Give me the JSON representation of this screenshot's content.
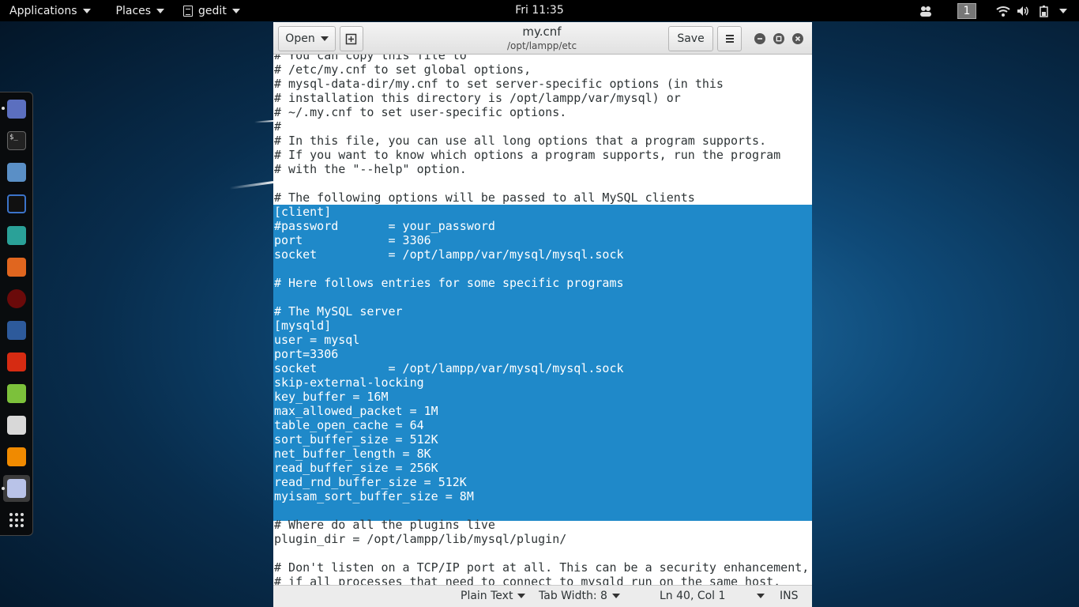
{
  "topbar": {
    "applications": "Applications",
    "places": "Places",
    "app_menu": "gedit",
    "clock": "Fri 11:35",
    "workspace": "1",
    "icons": [
      "people-icon",
      "wifi-icon",
      "volume-icon",
      "battery-icon",
      "power-menu-chevron-icon"
    ]
  },
  "dock": {
    "items": [
      "pidgin-icon",
      "terminal-icon",
      "files-icon",
      "metasploit-icon",
      "maltego-icon",
      "burpsuite-icon",
      "armitage-icon",
      "zaproxy-icon",
      "faraday-icon",
      "leafpad-icon",
      "cherrytree-icon",
      "vlc-icon",
      "gedit-icon",
      "show-apps-icon"
    ]
  },
  "window": {
    "title": "my.cnf",
    "subtitle": "/opt/lampp/etc",
    "open_label": "Open",
    "save_label": "Save",
    "new_tab_icon": "new-document-icon",
    "menu_icon": "hamburger-menu-icon",
    "controls": [
      "minimize-icon",
      "maximize-icon",
      "close-icon"
    ]
  },
  "editor": {
    "lines": [
      "# You can copy this file to",
      "# /etc/my.cnf to set global options,",
      "# mysql-data-dir/my.cnf to set server-specific options (in this",
      "# installation this directory is /opt/lampp/var/mysql) or",
      "# ~/.my.cnf to set user-specific options.",
      "#",
      "# In this file, you can use all long options that a program supports.",
      "# If you want to know which options a program supports, run the program",
      "# with the \"--help\" option.",
      "",
      "# The following options will be passed to all MySQL clients",
      "[client]",
      "#password       = your_password",
      "port            = 3306",
      "socket          = /opt/lampp/var/mysql/mysql.sock",
      "",
      "# Here follows entries for some specific programs",
      "",
      "# The MySQL server",
      "[mysqld]",
      "user = mysql",
      "port=3306",
      "socket          = /opt/lampp/var/mysql/mysql.sock",
      "skip-external-locking",
      "key_buffer = 16M",
      "max_allowed_packet = 1M",
      "table_open_cache = 64",
      "sort_buffer_size = 512K",
      "net_buffer_length = 8K",
      "read_buffer_size = 256K",
      "read_rnd_buffer_size = 512K",
      "myisam_sort_buffer_size = 8M",
      "",
      "# Where do all the plugins live",
      "plugin_dir = /opt/lampp/lib/mysql/plugin/",
      "",
      "# Don't listen on a TCP/IP port at all. This can be a security enhancement,",
      "# if all processes that need to connect to mysqld run on the same host."
    ],
    "selection": {
      "first_line": 11,
      "last_line": 32
    },
    "colors": {
      "selection": "#1f89c9",
      "text": "#2e3436"
    }
  },
  "statusbar": {
    "language": "Plain Text",
    "tab_width": "Tab Width: 8",
    "position": "Ln 40, Col 1",
    "mode": "INS"
  }
}
